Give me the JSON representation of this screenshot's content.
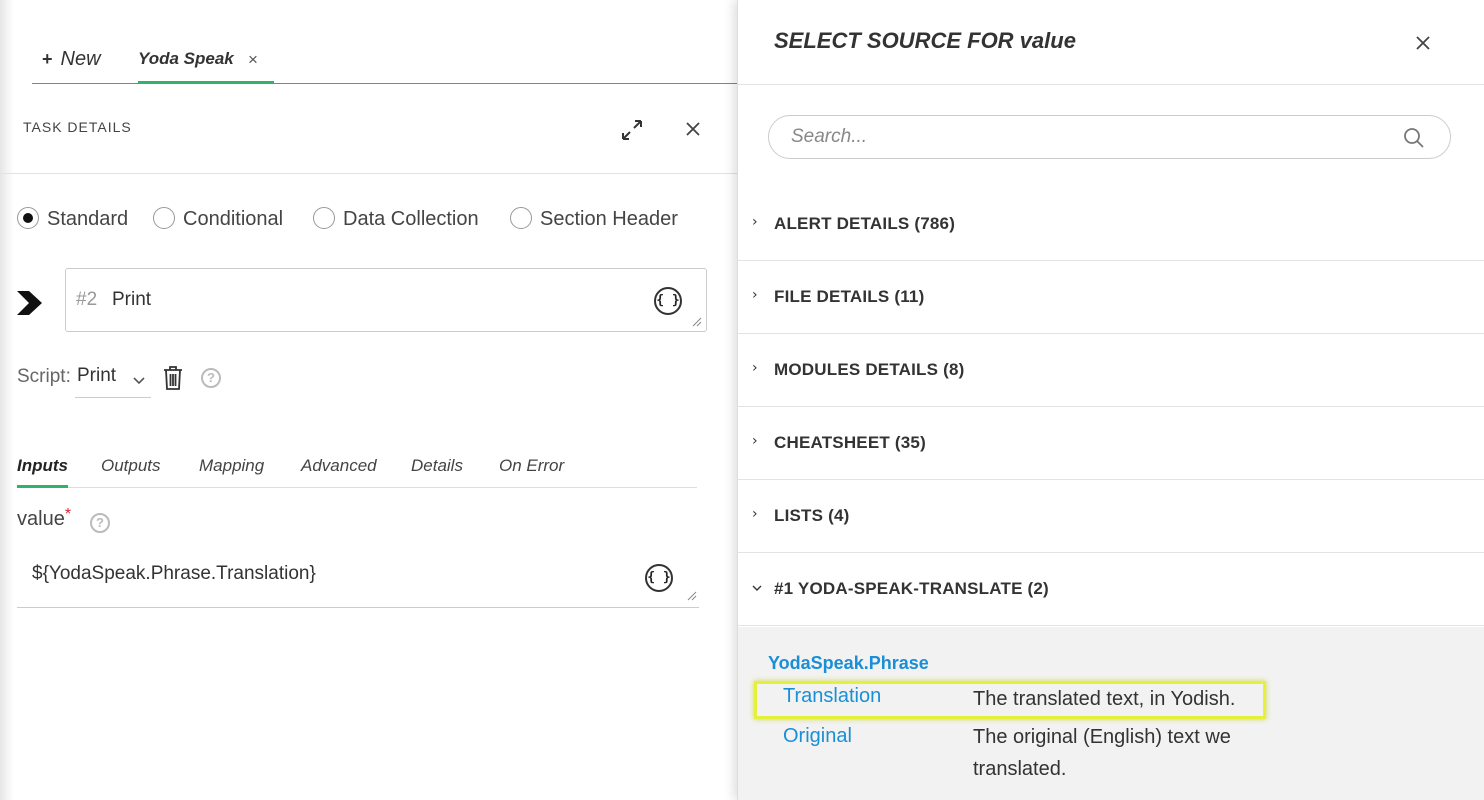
{
  "tabs": {
    "new_label": "New",
    "active_label": "Yoda Speak",
    "close_glyph": "×"
  },
  "task": {
    "header_title": "TASK DETAILS",
    "types": [
      {
        "label": "Standard",
        "selected": true
      },
      {
        "label": "Conditional",
        "selected": false
      },
      {
        "label": "Data Collection",
        "selected": false
      },
      {
        "label": "Section Header",
        "selected": false
      }
    ],
    "number": "#2",
    "name": "Print",
    "script_label": "Script:",
    "script_value": "Print",
    "sub_tabs": [
      "Inputs",
      "Outputs",
      "Mapping",
      "Advanced",
      "Details",
      "On Error"
    ],
    "active_sub_tab": "Inputs",
    "input_label": "value",
    "input_required_mark": "*",
    "input_value": "${YodaSpeak.Phrase.Translation}",
    "brace_glyph": "{ }"
  },
  "source_panel": {
    "title": "SELECT SOURCE FOR value",
    "search_placeholder": "Search...",
    "groups": [
      {
        "title": "ALERT DETAILS (786)",
        "expanded": false
      },
      {
        "title": "FILE DETAILS (11)",
        "expanded": false
      },
      {
        "title": "MODULES DETAILS (8)",
        "expanded": false
      },
      {
        "title": "CHEATSHEET (35)",
        "expanded": false
      },
      {
        "title": "LISTS (4)",
        "expanded": false
      },
      {
        "title": "#1 YODA-SPEAK-TRANSLATE (2)",
        "expanded": true
      }
    ],
    "expanded_group": {
      "object": "YodaSpeak.Phrase",
      "fields": [
        {
          "key": "Translation",
          "description": "The translated text, in Yodish.",
          "highlighted": true
        },
        {
          "key": "Original",
          "description": "The original (English) text we translated.",
          "highlighted": false
        }
      ]
    }
  },
  "colors": {
    "accent_green": "#2db36b",
    "link_blue": "#1a8fd6",
    "highlight_yellow": "#e5f03a",
    "required_red": "#d9232f"
  },
  "icons": [
    "plus-icon",
    "close-icon",
    "expand-icon",
    "chevron-right-icon",
    "braces-icon",
    "resize-handle-icon",
    "chevron-down-icon",
    "trash-icon",
    "help-icon",
    "search-icon",
    "caret-icon"
  ]
}
